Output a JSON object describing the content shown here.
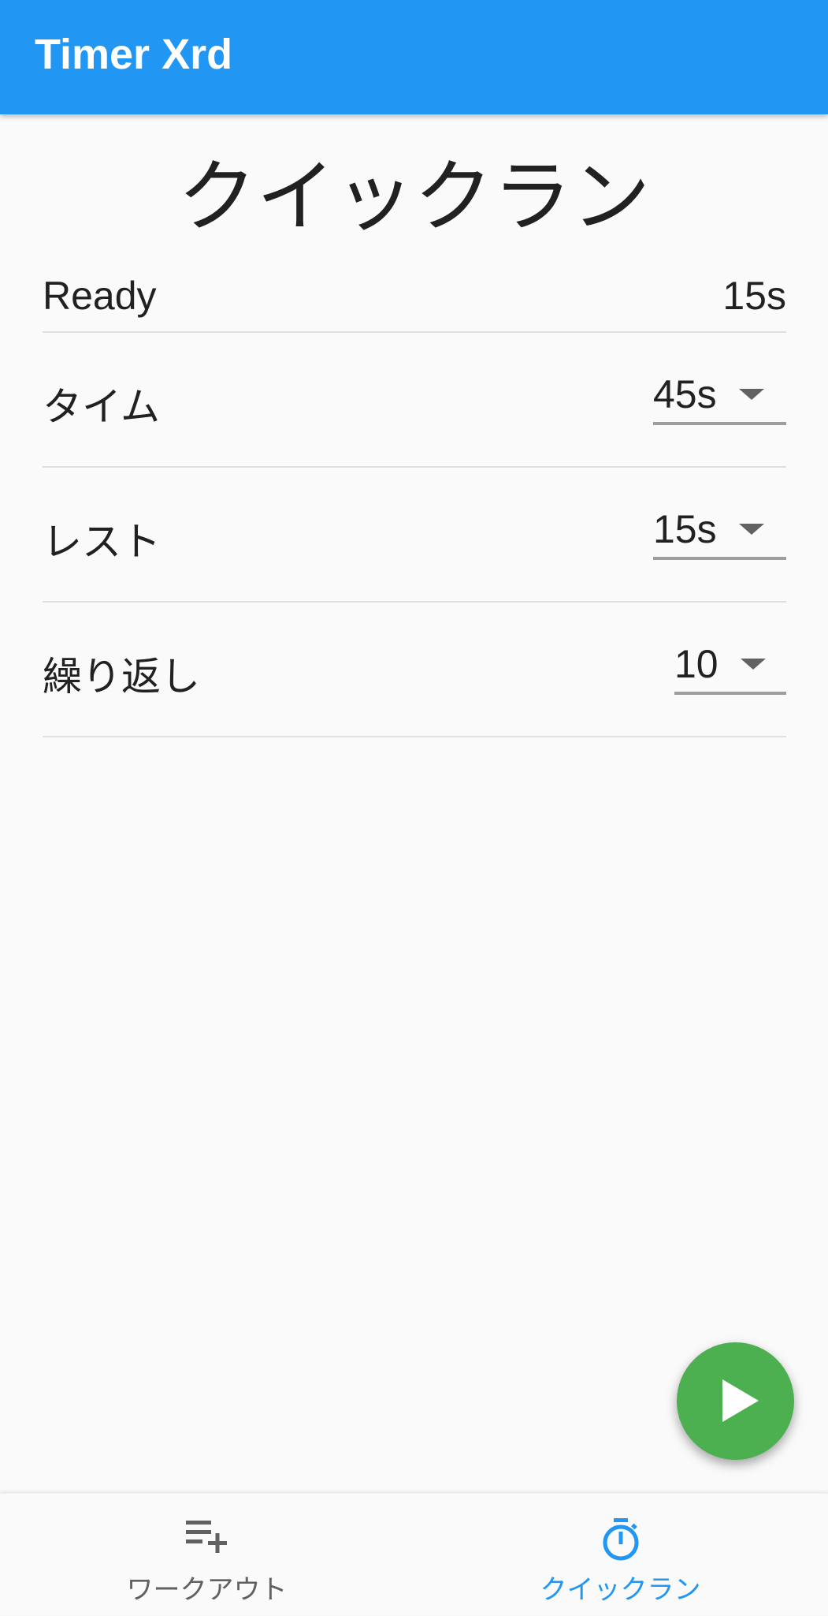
{
  "app": {
    "title": "Timer Xrd"
  },
  "page": {
    "title": "クイックラン"
  },
  "status": {
    "label": "Ready",
    "value": "15s"
  },
  "settings": [
    {
      "label": "タイム",
      "value": "45s"
    },
    {
      "label": "レスト",
      "value": "15s"
    },
    {
      "label": "繰り返し",
      "value": "10"
    }
  ],
  "fab": {
    "icon": "play-icon",
    "color": "#4caf50"
  },
  "bottom_nav": {
    "items": [
      {
        "label": "ワークアウト",
        "icon": "playlist-add-icon",
        "active": false
      },
      {
        "label": "クイックラン",
        "icon": "timer-icon",
        "active": true
      }
    ],
    "active_color": "#2196f3",
    "inactive_color": "#616161"
  },
  "colors": {
    "appbar": "#2196f3",
    "background": "#fafafa"
  }
}
